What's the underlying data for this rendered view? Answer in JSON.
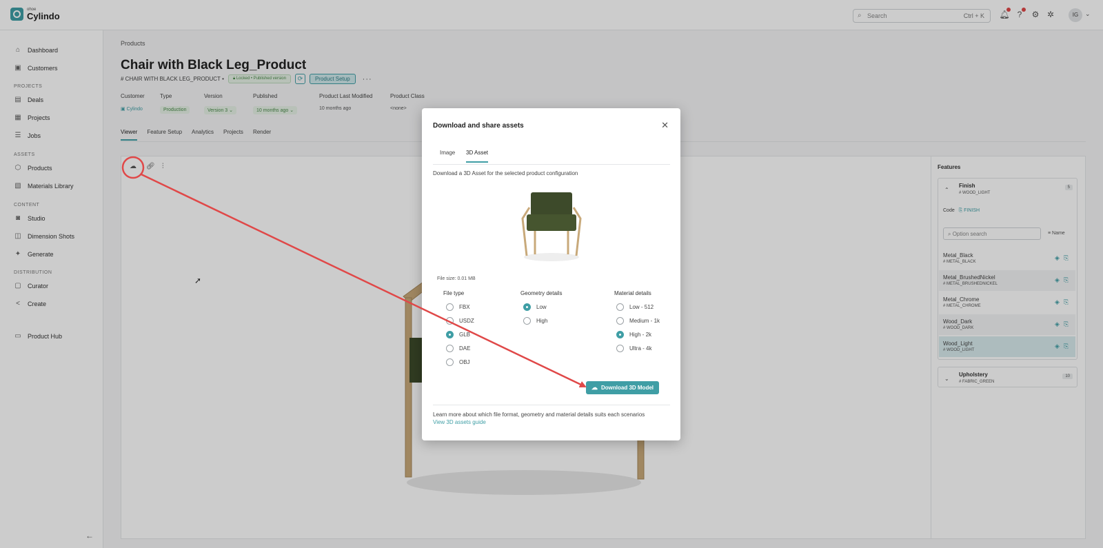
{
  "app": {
    "logo_small": "ohoe",
    "logo_big": "Cylindo"
  },
  "topbar": {
    "search_placeholder": "Search",
    "search_shortcut": "Ctrl + K",
    "avatar": "IG"
  },
  "sidebar": {
    "items_top": [
      "Dashboard",
      "Customers"
    ],
    "section_projects": "PROJECTS",
    "items_projects": [
      "Deals",
      "Projects",
      "Jobs"
    ],
    "section_assets": "ASSETS",
    "items_assets": [
      "Products",
      "Materials Library"
    ],
    "section_content": "CONTENT",
    "items_content": [
      "Studio",
      "Dimension Shots",
      "Generate"
    ],
    "section_distribution": "DISTRIBUTION",
    "items_distribution": [
      "Curator",
      "Create"
    ],
    "product_hub": "Product Hub"
  },
  "page": {
    "breadcrumb": "Products",
    "title": "Chair with Black Leg_Product",
    "code": "CHAIR WITH BLACK LEG_PRODUCT",
    "lock_status": "Locked • Published version",
    "setup_button": "Product Setup",
    "meta": {
      "customer_h": "Customer",
      "customer_v": "Cylindo",
      "type_h": "Type",
      "type_v": "Production",
      "version_h": "Version",
      "version_v": "Version 3",
      "published_h": "Published",
      "published_v": "10 months ago",
      "modified_h": "Product Last Modified",
      "modified_v": "10 months ago",
      "class_h": "Product Class",
      "class_v": "<none>"
    },
    "tabs": [
      "Viewer",
      "Feature Setup",
      "Analytics",
      "Projects",
      "Render"
    ]
  },
  "features": {
    "title": "Features",
    "finish": {
      "name": "Finish",
      "code": "# WOOD_LIGHT",
      "count": "5"
    },
    "code_label": "Code",
    "code_value": "FINISH",
    "option_search_placeholder": "Option search",
    "sort_label": "Name",
    "options": [
      {
        "name": "Metal_Black",
        "code": "# METAL_BLACK"
      },
      {
        "name": "Metal_BrushedNickel",
        "code": "# METAL_BRUSHEDNICKEL"
      },
      {
        "name": "Metal_Chrome",
        "code": "# METAL_CHROME"
      },
      {
        "name": "Wood_Dark",
        "code": "# WOOD_DARK"
      },
      {
        "name": "Wood_Light",
        "code": "# WOOD_LIGHT"
      }
    ],
    "upholstery": {
      "name": "Upholstery",
      "code": "# FABRIC_GREEN",
      "count": "10"
    }
  },
  "modal": {
    "title": "Download and share assets",
    "tabs": [
      "Image",
      "3D Asset"
    ],
    "active_tab": "3D Asset",
    "description": "Download a 3D Asset for the selected product configuration",
    "file_size": "File size: 0.01 MB",
    "file_type_h": "File type",
    "file_types": [
      "FBX",
      "USDZ",
      "GLB",
      "DAE",
      "OBJ"
    ],
    "file_type_selected": "GLB",
    "geometry_h": "Geometry details",
    "geometry": [
      "Low",
      "High"
    ],
    "geometry_selected": "Low",
    "material_h": "Material details",
    "materials": [
      "Low - 512",
      "Medium - 1k",
      "High - 2k",
      "Ultra - 4k"
    ],
    "material_selected": "High - 2k",
    "download_button": "Download 3D Model",
    "learn_text": "Learn more about which file format, geometry and material details suits each scenarios",
    "guide_link": "View 3D assets guide"
  },
  "colors": {
    "accent": "#3f9ea5",
    "annotation": "#e04848"
  }
}
